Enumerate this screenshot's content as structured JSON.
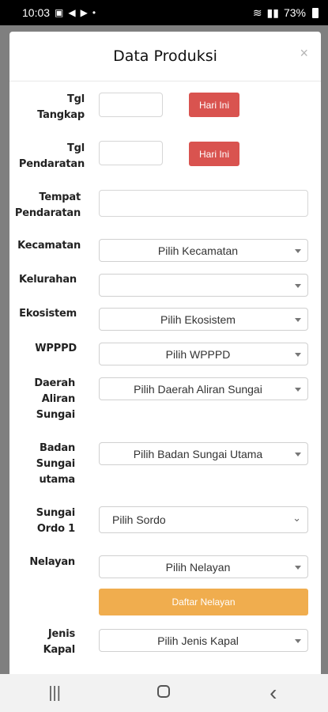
{
  "status_bar": {
    "time": "10:03",
    "left_icons": [
      "image-icon",
      "send-icon",
      "youtube-icon",
      "dot-icon"
    ],
    "battery": "73%"
  },
  "modal": {
    "title": "Data Produksi",
    "close_label": "×"
  },
  "form": {
    "tgl_tangkap": {
      "label": "Tgl Tangkap",
      "button": "Hari Ini"
    },
    "tgl_pendaratan": {
      "label": "Tgl Pendaratan",
      "button": "Hari Ini"
    },
    "tempat_pendaratan": {
      "label": "Tempat Pendaratan"
    },
    "kecamatan": {
      "label": "Kecamatan",
      "value": "Pilih Kecamatan"
    },
    "kelurahan": {
      "label": "Kelurahan",
      "value": ""
    },
    "ekosistem": {
      "label": "Ekosistem",
      "value": "Pilih Ekosistem"
    },
    "wpppd": {
      "label": "WPPPD",
      "value": "Pilih WPPPD"
    },
    "das": {
      "label": "Daerah Aliran Sungai",
      "value": "Pilih Daerah Aliran Sungai"
    },
    "badan_sungai": {
      "label": "Badan Sungai utama",
      "value": "Pilih Badan Sungai Utama"
    },
    "sungai_ordo": {
      "label": "Sungai Ordo 1",
      "value": "Pilih Sordo"
    },
    "nelayan": {
      "label": "Nelayan",
      "value": "Pilih Nelayan",
      "button": "Daftar Nelayan"
    },
    "jenis_kapal": {
      "label": "Jenis Kapal",
      "value": "Pilih Jenis Kapal"
    }
  },
  "nav": {
    "recents": "|||",
    "back": "‹"
  }
}
